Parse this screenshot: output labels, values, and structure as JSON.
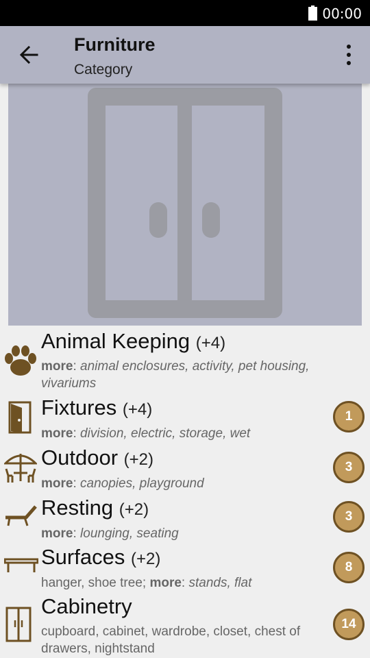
{
  "status_bar": {
    "time": "00:00"
  },
  "app_bar": {
    "title": "Furniture",
    "subtitle": "Category"
  },
  "hero": {
    "icon": "cabinet-doors-icon"
  },
  "colors": {
    "accent": "#c19a5b",
    "badge_border": "#6e5123",
    "icon_brown": "#6e5123",
    "app_bar": "#b1b3c3"
  },
  "categories": [
    {
      "title": "Animal Keeping",
      "count": "(+4)",
      "prefix": "",
      "more_label": "more",
      "more_text": "animal enclosures, activity, pet housing, vivariums",
      "badge": "",
      "icon": "paw-icon"
    },
    {
      "title": "Fixtures",
      "count": "(+4)",
      "prefix": "",
      "more_label": "more",
      "more_text": "division, electric, storage, wet",
      "badge": "1",
      "icon": "door-icon"
    },
    {
      "title": "Outdoor",
      "count": "(+2)",
      "prefix": "",
      "more_label": "more",
      "more_text": "canopies, playground",
      "badge": "3",
      "icon": "patio-table-icon"
    },
    {
      "title": "Resting",
      "count": "(+2)",
      "prefix": "",
      "more_label": "more",
      "more_text": "lounging, seating",
      "badge": "3",
      "icon": "lounger-icon"
    },
    {
      "title": "Surfaces",
      "count": "(+2)",
      "prefix": "hanger, shoe tree;",
      "more_label": "more",
      "more_text": "stands, flat",
      "badge": "8",
      "icon": "table-icon"
    },
    {
      "title": "Cabinetry",
      "count": "",
      "prefix": "cupboard, cabinet, wardrobe, closet, chest of drawers, nightstand",
      "more_label": "",
      "more_text": "",
      "badge": "14",
      "icon": "cabinet-icon"
    }
  ]
}
